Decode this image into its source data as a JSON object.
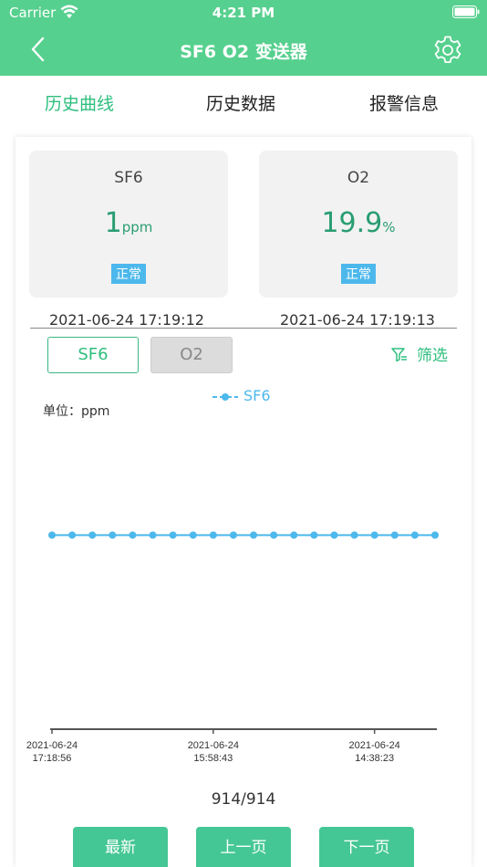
{
  "status_bar": {
    "carrier": "Carrier",
    "time": "4:21 PM"
  },
  "nav": {
    "title": "SF6 O2 变送器"
  },
  "tabs": [
    {
      "label": "历史曲线",
      "active": true
    },
    {
      "label": "历史数据",
      "active": false
    },
    {
      "label": "报警信息",
      "active": false
    }
  ],
  "sensors": [
    {
      "name": "SF6",
      "value": "1",
      "unit": "ppm",
      "status": "正常",
      "timestamp": "2021-06-24 17:19:12"
    },
    {
      "name": "O2",
      "value": "19.9",
      "unit": "%",
      "status": "正常",
      "timestamp": "2021-06-24 17:19:13"
    }
  ],
  "toggles": {
    "sf6": "SF6",
    "o2": "O2"
  },
  "filter_label": "筛选",
  "unit_label": "单位：ppm",
  "colors": {
    "header": "#56d08e",
    "accent": "#2fbf7e",
    "series": "#4db8ec",
    "button": "#45c795"
  },
  "chart_data": {
    "type": "line",
    "series": [
      {
        "name": "SF6",
        "values": [
          1,
          1,
          1,
          1,
          1,
          1,
          1,
          1,
          1,
          1,
          1,
          1,
          1,
          1,
          1,
          1,
          1,
          1,
          1,
          1
        ]
      }
    ],
    "x_ticks": [
      {
        "date": "2021-06-24",
        "time": "17:18:56",
        "index": 0
      },
      {
        "date": "2021-06-24",
        "time": "15:58:43",
        "index": 8
      },
      {
        "date": "2021-06-24",
        "time": "14:38:23",
        "index": 16
      }
    ],
    "ylabel": "单位：ppm",
    "ylim": [
      0,
      1.5
    ],
    "grid": false,
    "legend": "top-center"
  },
  "pagination": {
    "counter": "914/914",
    "latest": "最新",
    "prev": "上一页",
    "next": "下一页"
  }
}
